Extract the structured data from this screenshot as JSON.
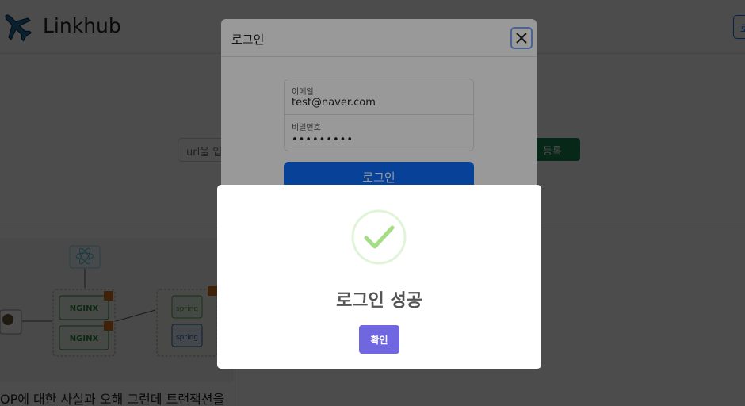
{
  "navbar": {
    "brand": "Linkhub",
    "logo_icon": "airplane-icon",
    "right_button_label": "로"
  },
  "main": {
    "url_placeholder": "url을 입력",
    "register_label": "등록",
    "card_title": "OP에 대한 사실과 오해 그런데 트랜잭션을"
  },
  "login_modal": {
    "title": "로그인",
    "close_icon": "close-icon",
    "email_label": "이메일",
    "email_value": "test@naver.com",
    "password_label": "비밀번호",
    "password_mask": "•••••••••",
    "submit_label": "로그인"
  },
  "alert": {
    "icon": "success-check-icon",
    "title": "로그인 성공",
    "confirm_label": "확인"
  },
  "colors": {
    "primary": "#0d6efd",
    "success": "#198754",
    "alert_confirm": "#7066e0",
    "check_green": "#a5dc86"
  }
}
